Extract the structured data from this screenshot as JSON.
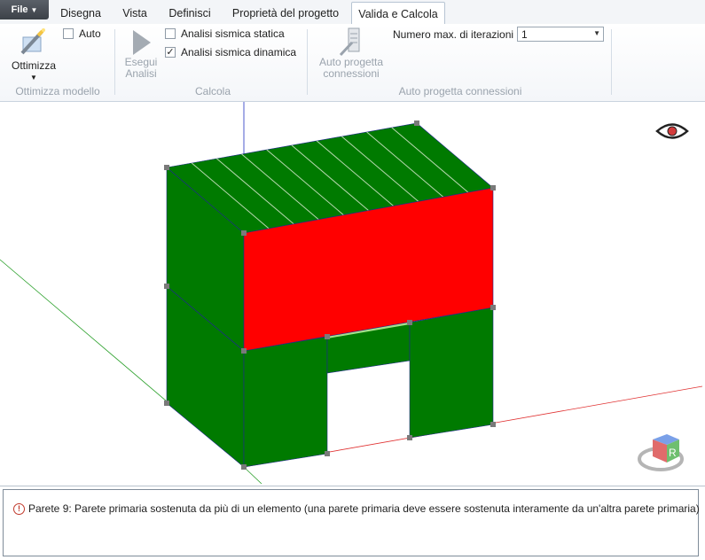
{
  "menu": {
    "file_label": "File",
    "tabs": [
      {
        "label": "Disegna",
        "active": false
      },
      {
        "label": "Vista",
        "active": false
      },
      {
        "label": "Definisci",
        "active": false
      },
      {
        "label": "Proprietà del progetto",
        "active": false
      },
      {
        "label": "Valida e Calcola",
        "active": true
      }
    ]
  },
  "ribbon": {
    "ottimizza": {
      "button_label": "Ottimizza",
      "auto_label": "Auto",
      "auto_checked": false,
      "group_label": "Ottimizza modello"
    },
    "calcola": {
      "run_label_1": "Esegui",
      "run_label_2": "Analisi",
      "static_label": "Analisi sismica statica",
      "static_checked": false,
      "dynamic_label": "Analisi sismica dinamica",
      "dynamic_checked": true,
      "group_label": "Calcola"
    },
    "connessioni": {
      "button_label_1": "Auto progetta",
      "button_label_2": "connessioni",
      "iterations_label": "Numero max. di iterazioni",
      "iterations_value": "1",
      "group_label": "Auto progetta connessioni"
    }
  },
  "viewport": {
    "colors": {
      "wall_green": "#007a00",
      "wall_red": "#ff0000",
      "roof_stripe": "#b8d8b0",
      "axis_x": "#e03030",
      "axis_y": "#2aa02a",
      "axis_z": "#2030c0",
      "beam_highlight": "#a6e08a"
    },
    "cube_label": "R",
    "eye_icon": "visibility-eye-icon"
  },
  "messages": [
    {
      "type": "error",
      "text": "Parete 9: Parete primaria sostenuta da più di un elemento (una parete primaria deve essere sostenuta interamente da un'altra parete primaria)"
    }
  ]
}
